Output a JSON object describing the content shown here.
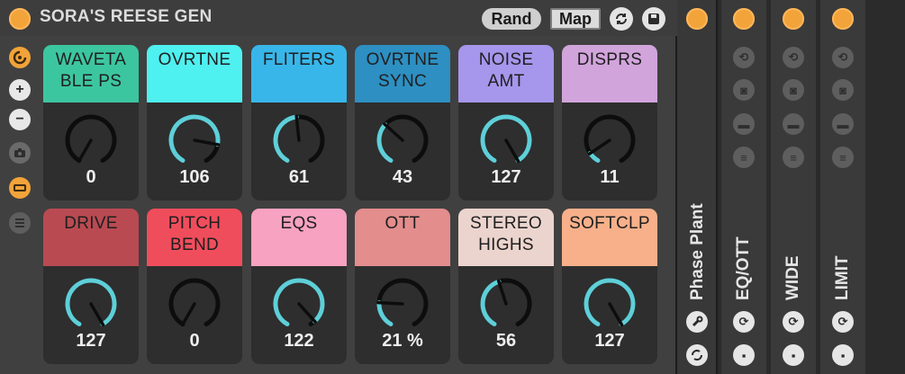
{
  "rack": {
    "title": "SORA'S REESE GEN",
    "rand_label": "Rand",
    "map_label": "Map",
    "accent_color": "#f2a33a",
    "side_icons": [
      "hotswap-icon",
      "plus-icon",
      "minus-icon",
      "camera-icon",
      "chain-icon",
      "list-icon"
    ]
  },
  "macros": [
    {
      "label": "WAVETA BLE PS",
      "value": "0",
      "level": 0.0,
      "color": "#3cc6a0"
    },
    {
      "label": "OVRTNE",
      "value": "106",
      "level": 0.835,
      "color": "#4ff0f0"
    },
    {
      "label": "FLITERS",
      "value": "61",
      "level": 0.48,
      "color": "#38b6ea"
    },
    {
      "label": "OVRTNE SYNC",
      "value": "43",
      "level": 0.34,
      "color": "#2d8fc2"
    },
    {
      "label": "NOISE AMT",
      "value": "127",
      "level": 1.0,
      "color": "#a696ec"
    },
    {
      "label": "DISPRS",
      "value": "11",
      "level": 0.087,
      "color": "#d2a4dc"
    },
    {
      "label": "DRIVE",
      "value": "127",
      "level": 1.0,
      "color": "#b94a52"
    },
    {
      "label": "PITCH BEND",
      "value": "0",
      "level": 0.0,
      "color": "#f04d5c"
    },
    {
      "label": "EQS",
      "value": "122",
      "level": 0.96,
      "color": "#f6a2c0"
    },
    {
      "label": "OTT",
      "value": "21 %",
      "level": 0.21,
      "color": "#e38d8d"
    },
    {
      "label": "STEREO HIGHS",
      "value": "56",
      "level": 0.44,
      "color": "#ecd4ce"
    },
    {
      "label": "SOFTCLP",
      "value": "127",
      "level": 1.0,
      "color": "#f7b08a"
    }
  ],
  "devices": [
    {
      "name": "Phase Plant"
    },
    {
      "name": "EQ/OTT"
    },
    {
      "name": "WIDE"
    },
    {
      "name": "LIMIT"
    }
  ],
  "icons": {
    "device_column": [
      "hotswap-icon",
      "camera-icon",
      "chain-icon",
      "list-icon"
    ],
    "device_bottom": [
      "settings-icon",
      "save-icon"
    ],
    "phase_bottom": [
      "wrench-icon",
      "settings-icon"
    ]
  }
}
